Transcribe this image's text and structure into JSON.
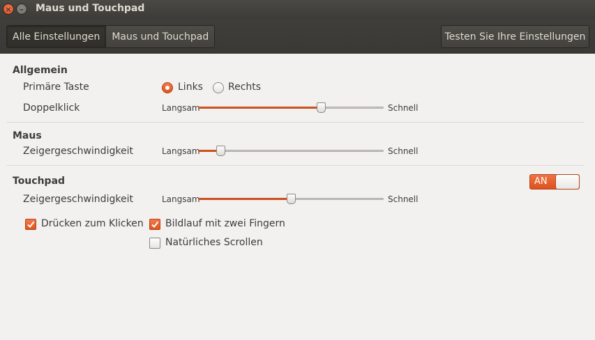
{
  "window": {
    "title": "Maus und Touchpad"
  },
  "toolbar": {
    "breadcrumbs": [
      "Alle Einstellungen",
      "Maus und Touchpad"
    ],
    "test_button": "Testen Sie Ihre Einstellungen"
  },
  "general": {
    "title": "Allgemein",
    "primary_button": {
      "label": "Primäre Taste",
      "options": [
        "Links",
        "Rechts"
      ],
      "selected": "Links"
    },
    "double_click": {
      "label": "Doppelklick",
      "min_label": "Langsam",
      "max_label": "Schnell",
      "value": 0.66
    }
  },
  "mouse": {
    "title": "Maus",
    "pointer_speed": {
      "label": "Zeigergeschwindigkeit",
      "min_label": "Langsam",
      "max_label": "Schnell",
      "value": 0.12
    }
  },
  "touchpad": {
    "title": "Touchpad",
    "switch": {
      "label": "AN",
      "on": true
    },
    "pointer_speed": {
      "label": "Zeigergeschwindigkeit",
      "min_label": "Langsam",
      "max_label": "Schnell",
      "value": 0.5
    },
    "tap_to_click": {
      "label": "Drücken zum Klicken",
      "checked": true
    },
    "two_finger_scroll": {
      "label": "Bildlauf mit zwei Fingern",
      "checked": true
    },
    "natural_scroll": {
      "label": "Natürliches Scrollen",
      "checked": false
    }
  },
  "colors": {
    "accent": "#e0541c",
    "titlebar": "#3c3b37",
    "background": "#f2f1f0"
  }
}
